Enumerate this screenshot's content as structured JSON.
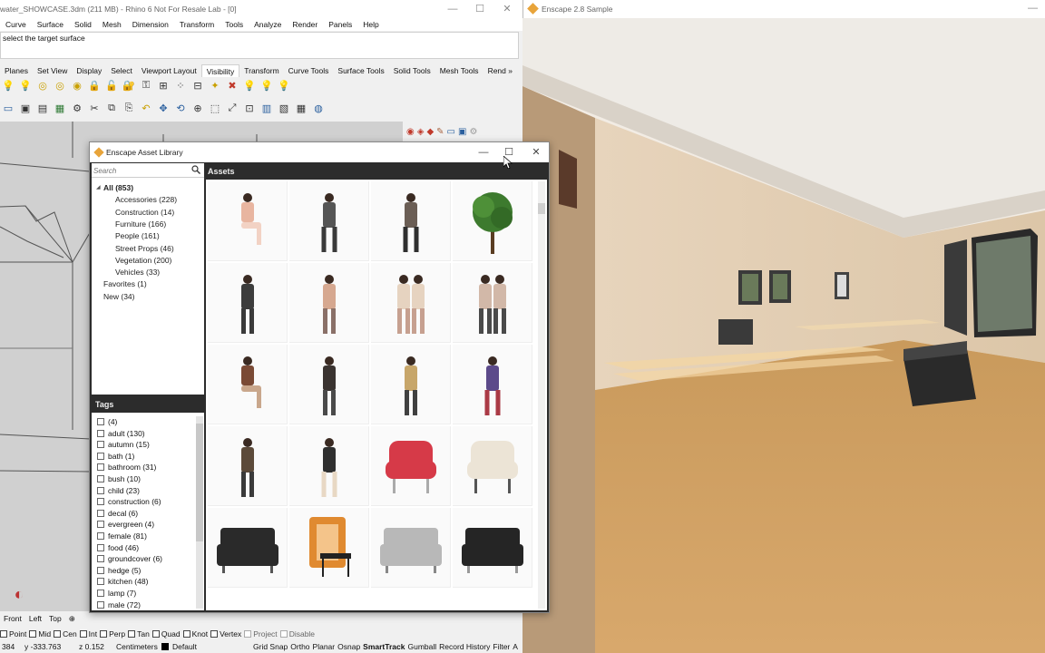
{
  "rhino": {
    "title": "water_SHOWCASE.3dm (211 MB) - Rhino 6 Not For Resale Lab - [0]",
    "menu": [
      "Curve",
      "Surface",
      "Solid",
      "Mesh",
      "Dimension",
      "Transform",
      "Tools",
      "Analyze",
      "Render",
      "Panels",
      "Help"
    ],
    "command_prompt": "select the target surface",
    "tabs": [
      "Planes",
      "Set View",
      "Display",
      "Select",
      "Viewport Layout",
      "Visibility",
      "Transform",
      "Curve Tools",
      "Surface Tools",
      "Solid Tools",
      "Mesh Tools",
      "Rend »"
    ],
    "active_tab": "Visibility",
    "view_tabs": [
      "Front",
      "Left",
      "Top",
      "⊕"
    ],
    "osnaps": [
      {
        "label": "Point",
        "enabled": true
      },
      {
        "label": "Mid",
        "enabled": true
      },
      {
        "label": "Cen",
        "enabled": true
      },
      {
        "label": "Int",
        "enabled": true
      },
      {
        "label": "Perp",
        "enabled": true
      },
      {
        "label": "Tan",
        "enabled": true
      },
      {
        "label": "Quad",
        "enabled": true
      },
      {
        "label": "Knot",
        "enabled": true
      },
      {
        "label": "Vertex",
        "enabled": true
      },
      {
        "label": "Project",
        "enabled": false
      },
      {
        "label": "Disable",
        "enabled": false
      }
    ],
    "status": {
      "x": "384",
      "y": "y -333.763",
      "z": "z 0.152",
      "units": "Centimeters",
      "layer": "Default",
      "items": [
        "Grid Snap",
        "Ortho",
        "Planar",
        "Osnap",
        "SmartTrack",
        "Gumball",
        "Record History",
        "Filter",
        "A"
      ]
    }
  },
  "enscape": {
    "title": "Enscape 2.8 Sample"
  },
  "library": {
    "title": "Enscape Asset Library",
    "search_placeholder": "Search",
    "assets_header": "Assets",
    "tags_header": "Tags",
    "categories": [
      {
        "label": "All (853)",
        "level": 0,
        "expanded": true
      },
      {
        "label": "Accessories (228)",
        "level": 1
      },
      {
        "label": "Construction (14)",
        "level": 1
      },
      {
        "label": "Furniture (166)",
        "level": 1
      },
      {
        "label": "People (161)",
        "level": 1
      },
      {
        "label": "Street Props (46)",
        "level": 1
      },
      {
        "label": "Vegetation (200)",
        "level": 1
      },
      {
        "label": "Vehicles (33)",
        "level": 1
      },
      {
        "label": "Favorites (1)",
        "level": 0
      },
      {
        "label": "New (34)",
        "level": 0
      }
    ],
    "tags": [
      "(4)",
      "adult (130)",
      "autumn (15)",
      "bath (1)",
      "bathroom (31)",
      "bush (10)",
      "child (23)",
      "construction (6)",
      "decal (6)",
      "evergreen (4)",
      "female (81)",
      "food (46)",
      "groundcover (6)",
      "hedge (5)",
      "kitchen (48)",
      "lamp (7)",
      "male (72)"
    ],
    "assets": [
      {
        "kind": "person",
        "shirt": "#e8b5a0",
        "legs": "#f2d2c4",
        "pose": "sit"
      },
      {
        "kind": "person",
        "shirt": "#555555",
        "legs": "#3a3a3a",
        "pose": "walk"
      },
      {
        "kind": "person",
        "shirt": "#6b5e55",
        "legs": "#2f2f2f",
        "pose": "walk"
      },
      {
        "kind": "tree",
        "shirt": "#3d7a2e",
        "legs": "#5a3d22"
      },
      {
        "kind": "person",
        "shirt": "#3c3c3c",
        "legs": "#3a3a3a",
        "pose": "stand"
      },
      {
        "kind": "person",
        "shirt": "#d6a890",
        "legs": "#8a7068",
        "pose": "stand"
      },
      {
        "kind": "person",
        "shirt": "#e6d3c0",
        "legs": "#c6a090",
        "pose": "group"
      },
      {
        "kind": "person",
        "shirt": "#d2b8a8",
        "legs": "#4a4a4a",
        "pose": "group"
      },
      {
        "kind": "person",
        "shirt": "#7a4a35",
        "legs": "#c9a78c",
        "pose": "sit"
      },
      {
        "kind": "person",
        "shirt": "#3a3330",
        "legs": "#4a4a4a",
        "pose": "stand"
      },
      {
        "kind": "person",
        "shirt": "#c7a66a",
        "legs": "#404040",
        "pose": "stand"
      },
      {
        "kind": "person",
        "shirt": "#5c4a8a",
        "legs": "#aa3a45",
        "pose": "run"
      },
      {
        "kind": "person",
        "shirt": "#5c4a3a",
        "legs": "#3a3a3a",
        "pose": "stand"
      },
      {
        "kind": "person",
        "shirt": "#2f2f2f",
        "legs": "#e8d8c4",
        "pose": "walk"
      },
      {
        "kind": "armchair",
        "shirt": "#d63a48",
        "legs": "#aaaaaa"
      },
      {
        "kind": "armchair",
        "shirt": "#ece4d6",
        "legs": "#555555"
      },
      {
        "kind": "sofa",
        "shirt": "#2a2a2a",
        "legs": "#555555"
      },
      {
        "kind": "booth",
        "shirt": "#e08a30",
        "legs": "#888888"
      },
      {
        "kind": "sofa",
        "shirt": "#b8b8b8",
        "legs": "#888888"
      },
      {
        "kind": "sofa",
        "shirt": "#252525",
        "legs": "#999999"
      }
    ]
  }
}
